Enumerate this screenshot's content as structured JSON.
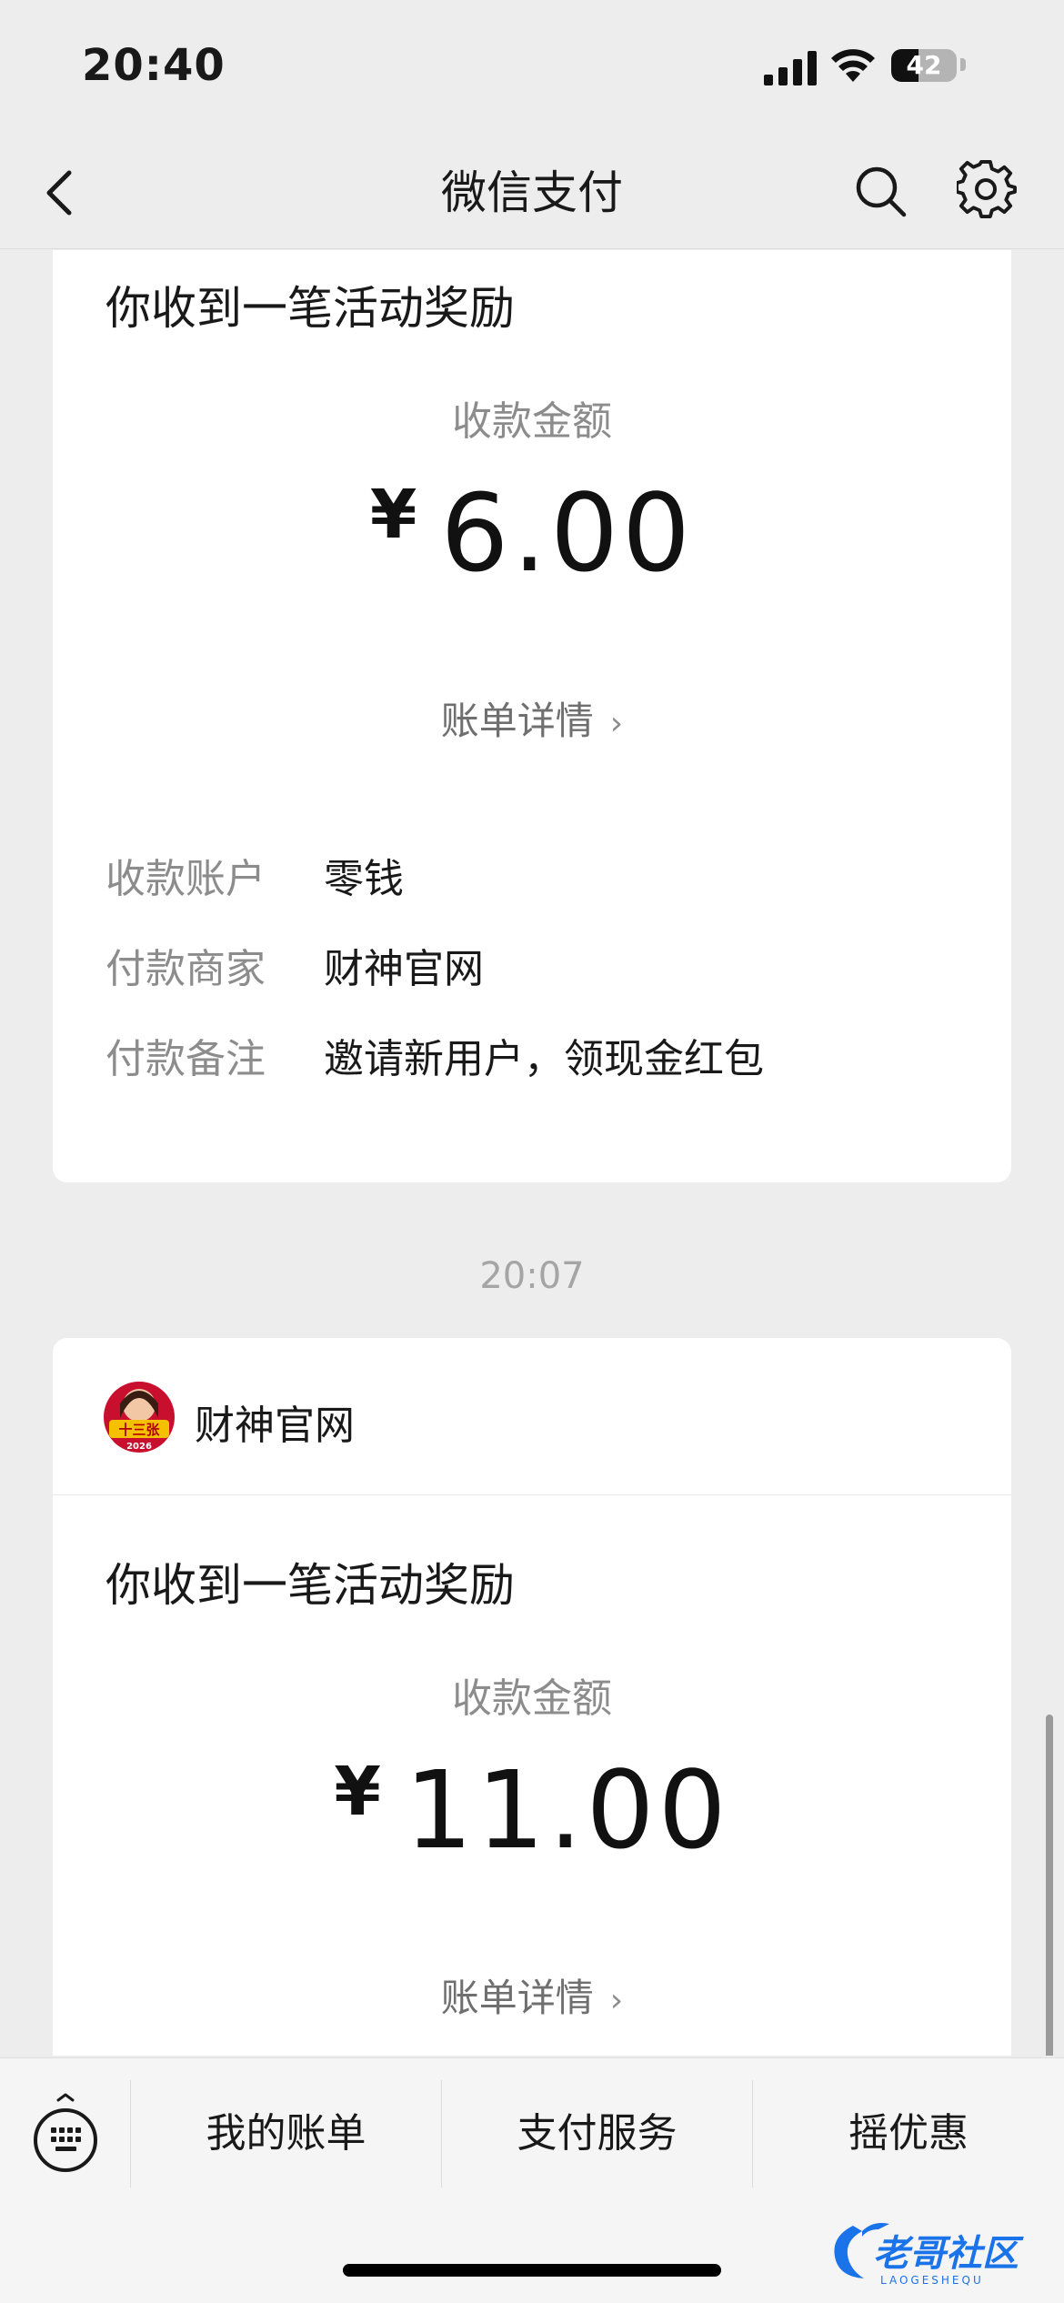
{
  "status_bar": {
    "time": "20:40",
    "battery": "42",
    "battery_level_percent": 42
  },
  "nav": {
    "title": "微信支付",
    "back_icon": "chevron-left-icon",
    "search_icon": "search-icon",
    "settings_icon": "gear-icon"
  },
  "message1": {
    "title": "你收到一笔活动奖励",
    "amount_label": "收款金额",
    "currency": "¥",
    "amount": "6.00",
    "detail_link": "账单详情",
    "rows": [
      {
        "label": "收款账户",
        "value": "零钱"
      },
      {
        "label": "付款商家",
        "value": "财神官网"
      },
      {
        "label": "付款备注",
        "value": "邀请新用户，领现金红包"
      }
    ]
  },
  "timestamp": "20:07",
  "message2": {
    "merchant_name": "财神官网",
    "avatar_text": "十三张",
    "avatar_year": "2026",
    "title": "你收到一笔活动奖励",
    "amount_label": "收款金额",
    "currency": "¥",
    "amount": "11.00",
    "detail_link": "账单详情"
  },
  "bottom_menu": {
    "keyboard_icon": "keyboard-icon",
    "items": [
      "我的账单",
      "支付服务",
      "摇优惠"
    ]
  },
  "watermark": {
    "text": "老哥社区",
    "subtext": "LAOGESHEQU"
  },
  "colors": {
    "background": "#ededed",
    "card": "#ffffff",
    "label_gray": "#8c8c8c",
    "text": "#191919"
  }
}
